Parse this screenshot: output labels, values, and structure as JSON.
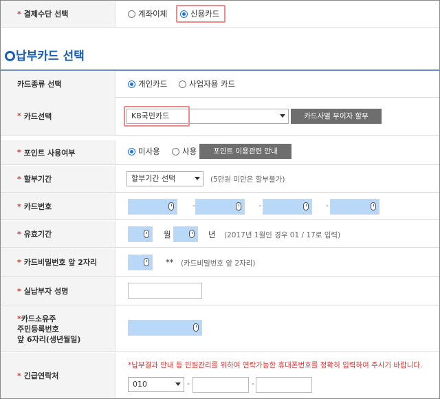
{
  "payment_method": {
    "label": "결제수단 선택",
    "options": [
      {
        "label": "계좌이체",
        "selected": false
      },
      {
        "label": "신용카드",
        "selected": true
      }
    ]
  },
  "section_title": "납부카드 선택",
  "card_type": {
    "label": "카드종류 선택",
    "options": [
      {
        "label": "개인카드",
        "selected": true
      },
      {
        "label": "사업자용 카드",
        "selected": false
      }
    ]
  },
  "card_select": {
    "label": "카드선택",
    "value": "KB국민카드",
    "button": "카드사별 무이자 할부"
  },
  "points": {
    "label": "포인트 사용여부",
    "options": [
      {
        "label": "미사용",
        "selected": true
      },
      {
        "label": "사용",
        "selected": false
      }
    ],
    "button": "포인트 이용관련 안내"
  },
  "installment": {
    "label": "할부기간",
    "select_value": "할부기간 선택",
    "hint": "(5만원 미만은 할부불가)"
  },
  "card_number": {
    "label": "카드번호",
    "separator": "-"
  },
  "expiry": {
    "label": "유효기간",
    "month_unit": "월",
    "year_unit": "년",
    "hint": "(2017년 1월인 경우 01 / 17로 입력)"
  },
  "card_password": {
    "label": "카드비밀번호 앞 2자리",
    "mask": "**",
    "hint": "(카드비밀번호 앞 2자리)"
  },
  "payer_name": {
    "label": "실납부자 성명"
  },
  "owner_id": {
    "label_line1": "카드소유주",
    "label_line2": "주민등록번호",
    "label_line3": "앞 6자리(생년월일)"
  },
  "emergency_contact": {
    "label": "긴급연락처",
    "notice": "*납부결과 안내 등 민원관리를 위하여 연락가능한 휴대폰번호를 정확히 입력하여 주시기 바랍니다.",
    "prefix": "010",
    "separator": "-"
  },
  "required_mark": "*",
  "colors": {
    "accent": "#1a5fb4",
    "highlight": "#f08a8a",
    "secure_field": "#b9d7f7",
    "required": "#d33"
  }
}
